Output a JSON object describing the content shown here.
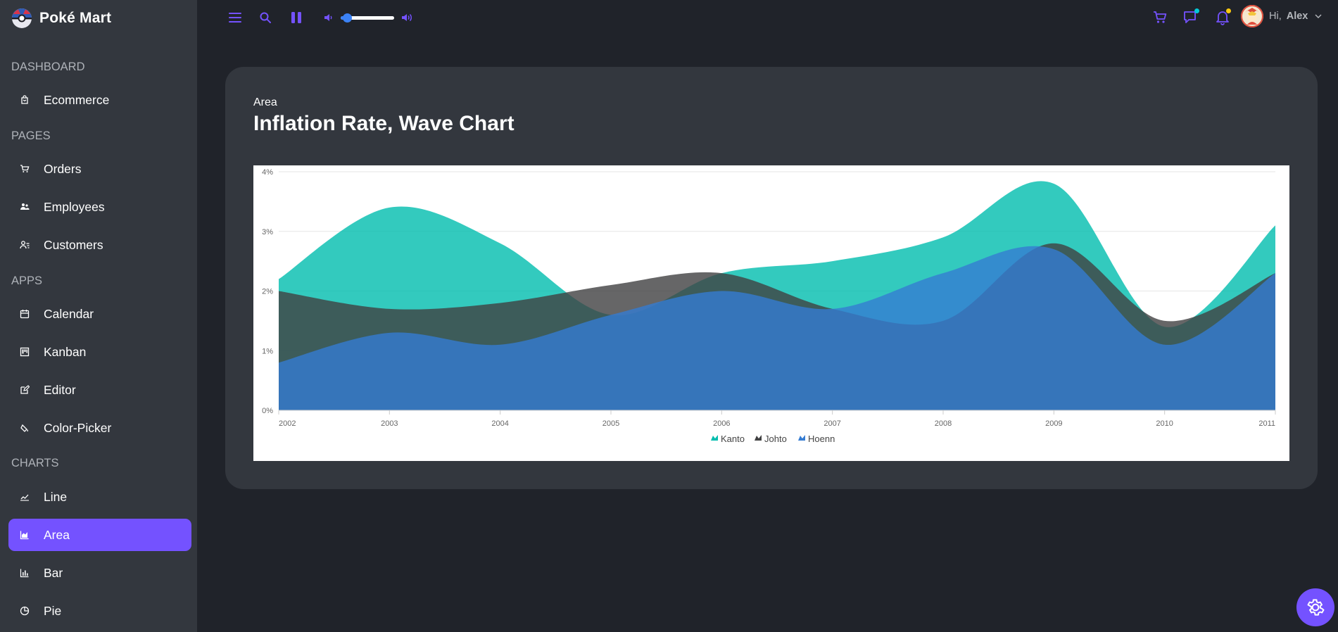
{
  "app": {
    "name": "Poké Mart"
  },
  "sidebar": {
    "sections": [
      {
        "title": "DASHBOARD",
        "items": [
          {
            "label": "Ecommerce",
            "icon": "bag-icon"
          }
        ]
      },
      {
        "title": "PAGES",
        "items": [
          {
            "label": "Orders",
            "icon": "cart-icon"
          },
          {
            "label": "Employees",
            "icon": "employees-icon"
          },
          {
            "label": "Customers",
            "icon": "customers-icon"
          }
        ]
      },
      {
        "title": "APPS",
        "items": [
          {
            "label": "Calendar",
            "icon": "calendar-icon"
          },
          {
            "label": "Kanban",
            "icon": "kanban-icon"
          },
          {
            "label": "Editor",
            "icon": "edit-icon"
          },
          {
            "label": "Color-Picker",
            "icon": "color-picker-icon"
          }
        ]
      },
      {
        "title": "CHARTS",
        "items": [
          {
            "label": "Line",
            "icon": "line-chart-icon"
          },
          {
            "label": "Area",
            "icon": "area-chart-icon",
            "active": true
          },
          {
            "label": "Bar",
            "icon": "bar-chart-icon"
          },
          {
            "label": "Pie",
            "icon": "pie-chart-icon"
          }
        ]
      }
    ]
  },
  "topbar": {
    "greeting": "Hi,",
    "username": "Alex",
    "volume": 0.12,
    "accent": "#7452ff",
    "chat_dot_color": "#03c9d7",
    "bell_dot_color": "#fec90f"
  },
  "card": {
    "subtitle": "Area",
    "title": "Inflation Rate, Wave Chart"
  },
  "chart_data": {
    "type": "area",
    "x": [
      "2002",
      "2003",
      "2004",
      "2005",
      "2006",
      "2007",
      "2008",
      "2009",
      "2010",
      "2011"
    ],
    "ylim": [
      0,
      4
    ],
    "yticks": [
      "0%",
      "1%",
      "2%",
      "3%",
      "4%"
    ],
    "grid": true,
    "legend_position": "bottom",
    "series": [
      {
        "name": "Kanto",
        "color": "#00bdae",
        "values": [
          2.2,
          3.4,
          2.8,
          1.6,
          2.3,
          2.5,
          2.9,
          3.8,
          1.4,
          3.1
        ]
      },
      {
        "name": "Johto",
        "color": "#404041",
        "values": [
          2.0,
          1.7,
          1.8,
          2.1,
          2.3,
          1.7,
          1.5,
          2.8,
          1.5,
          2.3
        ]
      },
      {
        "name": "Hoenn",
        "color": "#357cd2",
        "values": [
          0.8,
          1.3,
          1.1,
          1.6,
          2.0,
          1.7,
          2.3,
          2.7,
          1.1,
          2.3
        ]
      }
    ]
  }
}
